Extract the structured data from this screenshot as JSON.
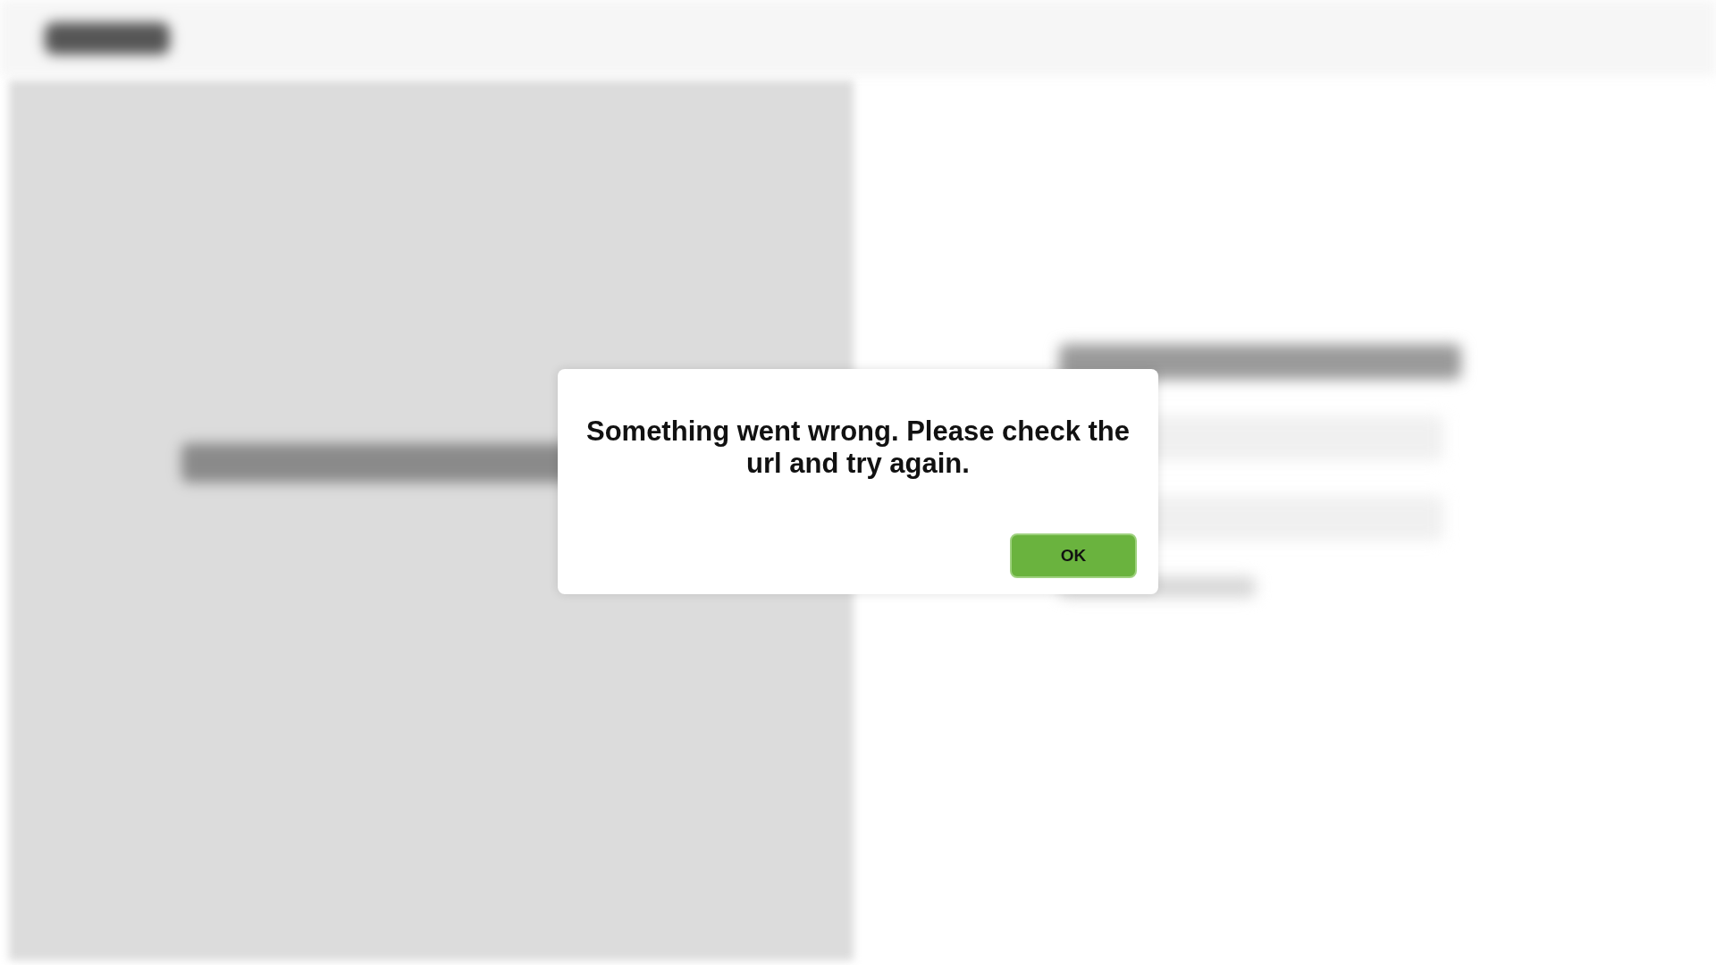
{
  "dialog": {
    "message": "Something went wrong. Please check the url and try again.",
    "buttons": [
      {
        "label": "OK"
      }
    ]
  }
}
